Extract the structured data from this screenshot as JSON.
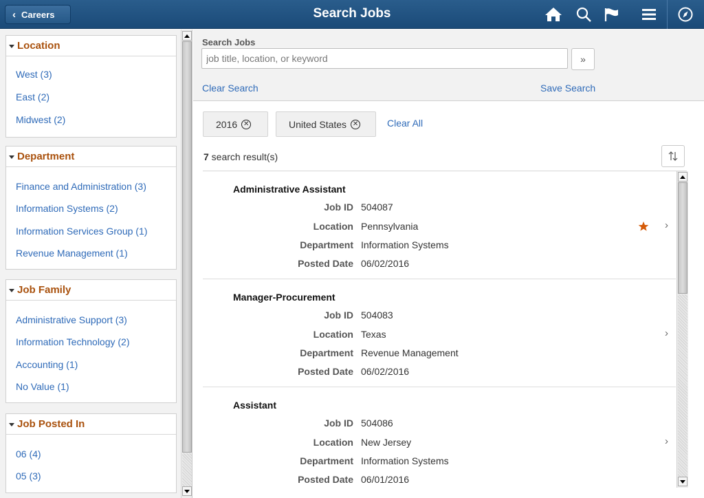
{
  "header": {
    "back_label": "Careers",
    "title": "Search Jobs",
    "icons": [
      "home-icon",
      "search-icon",
      "flag-icon",
      "menu-icon",
      "navbar-compass-icon"
    ]
  },
  "facets": [
    {
      "title": "Location",
      "items": [
        "West (3)",
        "East (2)",
        "Midwest (2)"
      ]
    },
    {
      "title": "Department",
      "items": [
        "Finance and Administration (3)",
        "Information Systems (2)",
        "Information Services Group (1)",
        "Revenue Management (1)"
      ]
    },
    {
      "title": "Job Family",
      "items": [
        "Administrative Support (3)",
        "Information Technology (2)",
        "Accounting (1)",
        "No Value (1)"
      ]
    },
    {
      "title": "Job Posted In",
      "items": [
        "06 (4)",
        "05 (3)"
      ]
    }
  ],
  "search": {
    "label": "Search Jobs",
    "placeholder": "job title, location, or keyword",
    "go_label": "»",
    "clear_label": "Clear Search",
    "save_label": "Save Search"
  },
  "filters": {
    "chips": [
      "2016",
      "United States"
    ],
    "clear_all_label": "Clear All"
  },
  "results_summary": {
    "count": "7",
    "suffix": " search result(s)"
  },
  "field_labels": {
    "job_id": "Job ID",
    "location": "Location",
    "department": "Department",
    "posted_date": "Posted Date"
  },
  "results": [
    {
      "title": "Administrative Assistant",
      "job_id": "504087",
      "location": "Pennsylvania",
      "department": "Information Systems",
      "posted_date": "06/02/2016",
      "favorite": true
    },
    {
      "title": "Manager-Procurement",
      "job_id": "504083",
      "location": "Texas",
      "department": "Revenue Management",
      "posted_date": "06/02/2016",
      "favorite": false
    },
    {
      "title": "Assistant",
      "job_id": "504086",
      "location": "New Jersey",
      "department": "Information Systems",
      "posted_date": "06/01/2016",
      "favorite": false
    }
  ],
  "colors": {
    "header": "#1f4f7e",
    "facet_title": "#a9510d",
    "link": "#2e6ab8",
    "star": "#d55b08"
  }
}
